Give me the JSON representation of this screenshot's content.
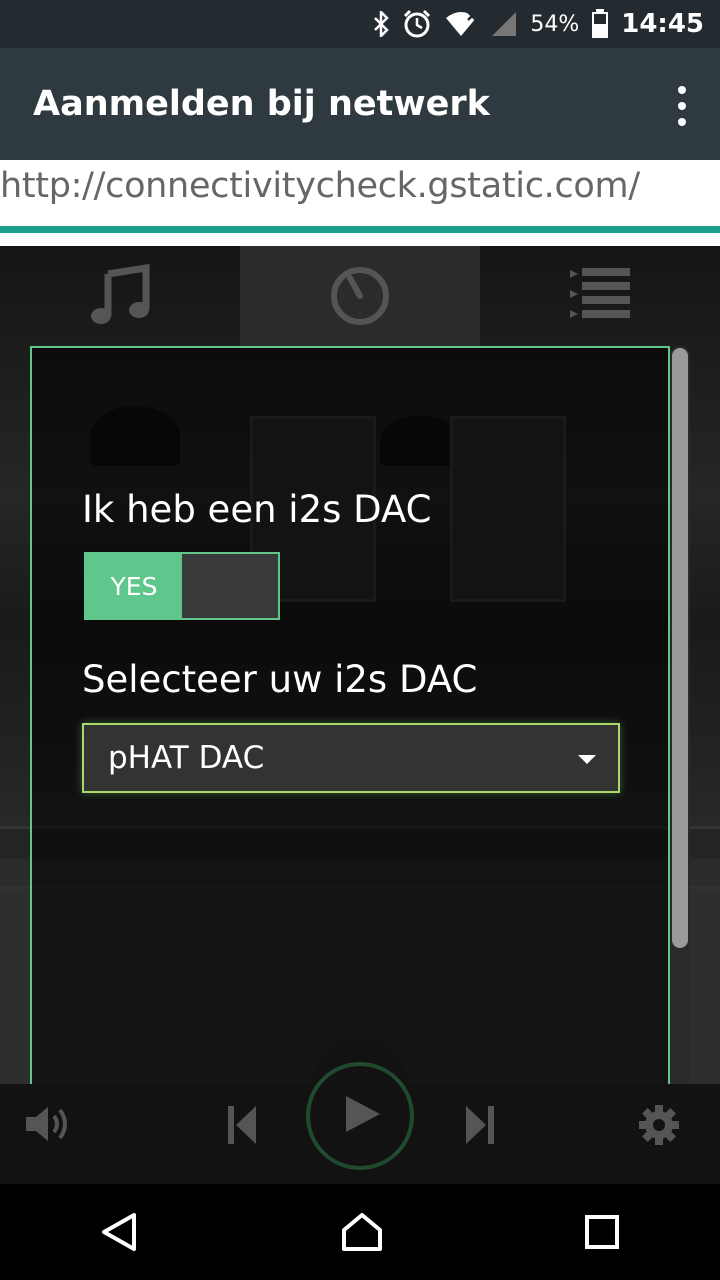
{
  "status_bar": {
    "icons": [
      "bluetooth-icon",
      "alarm-icon",
      "wifi-icon",
      "signal-icon",
      "battery-icon"
    ],
    "battery": "54%",
    "time": "14:45"
  },
  "app_bar": {
    "title": "Aanmelden bij netwerk",
    "menu_icon": "more-vert-icon"
  },
  "url_bar": {
    "url": "http://connectivitycheck.gstatic.com/",
    "accent_color": "#1b9e8c"
  },
  "tabs": [
    {
      "icon": "music-note-icon",
      "active": false
    },
    {
      "icon": "timer-icon",
      "active": true
    },
    {
      "icon": "playlist-icon",
      "active": false
    }
  ],
  "settings_panel": {
    "dac_question": "Ik heb een i2s DAC",
    "toggle": {
      "on_label": "YES",
      "state": "on"
    },
    "select_label": "Selecteer uw i2s DAC",
    "select_value": "pHAT DAC",
    "accent_color": "#5fc78c"
  },
  "player": {
    "icons": [
      "volume-icon",
      "previous-icon",
      "play-icon",
      "next-icon",
      "settings-gear-icon"
    ]
  },
  "nav_bar": {
    "icons": [
      "back-icon",
      "home-icon",
      "recents-icon"
    ]
  }
}
